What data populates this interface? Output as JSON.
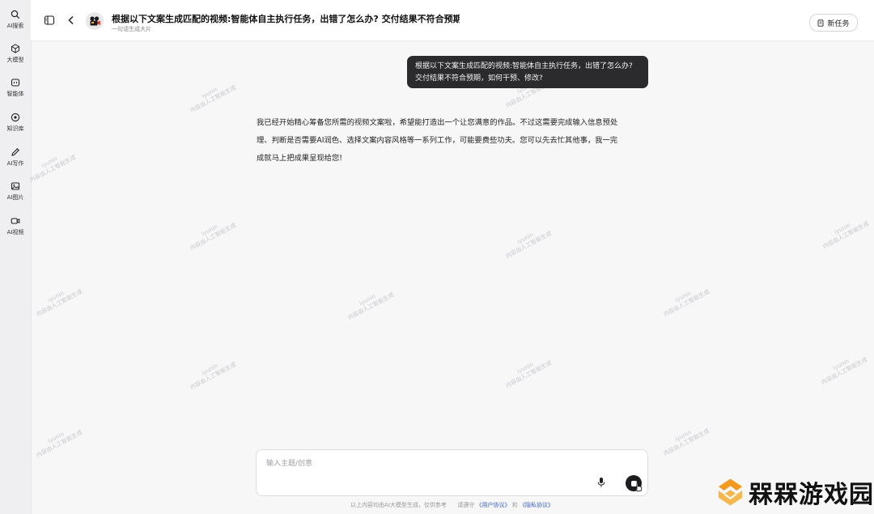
{
  "sidebar": {
    "items": [
      {
        "label": "AI搜索",
        "icon": "search-icon"
      },
      {
        "label": "大模型",
        "icon": "cube-icon"
      },
      {
        "label": "智能体",
        "icon": "agent-icon"
      },
      {
        "label": "知识库",
        "icon": "knowledge-icon"
      },
      {
        "label": "AI写作",
        "icon": "pen-icon"
      },
      {
        "label": "AI图片",
        "icon": "image-icon"
      },
      {
        "label": "AI视频",
        "icon": "video-icon"
      }
    ]
  },
  "header": {
    "title": "根据以下文案生成匹配的视频:智能体自主执行任务，出错了怎么办? 交付结果不符合预期，...",
    "subtitle": "一句话生成大片",
    "new_task_label": "新任务"
  },
  "chat": {
    "user_message_line1": "根据以下文案生成匹配的视频:智能体自主执行任务，出错了怎么办?",
    "user_message_line2": "交付结果不符合预期，如何干预、修改?",
    "ai_message_line1": "我已经开始精心筹备您所需的视频文案啦，希望能打造出一个让您满意的作品。不过这需要完成输入信息预处",
    "ai_message_line2": "理、判断是否需要AI润色、选择文案内容风格等一系列工作，可能要费些功夫。您可以先去忙其他事，我一完",
    "ai_message_line3": "成就马上把成果呈现给您!"
  },
  "watermark": {
    "line1": "iyunin",
    "line2": "内容由人工智能生成"
  },
  "composer": {
    "placeholder": "输入主题/创意"
  },
  "footer": {
    "disclaimer": "以上内容均由AI大模型生成，仅供参考",
    "agree_prefix": "请遵守",
    "user_agreement": "《用户协议》",
    "and": "和",
    "privacy_agreement": "《隐私协议》"
  },
  "brand": {
    "text": "槑槑游戏园"
  },
  "colors": {
    "accent_dark": "#1d1d1f",
    "bubble": "#2b2b2e",
    "link": "#3a5fc8",
    "brand_orange": "#f39a1e"
  }
}
